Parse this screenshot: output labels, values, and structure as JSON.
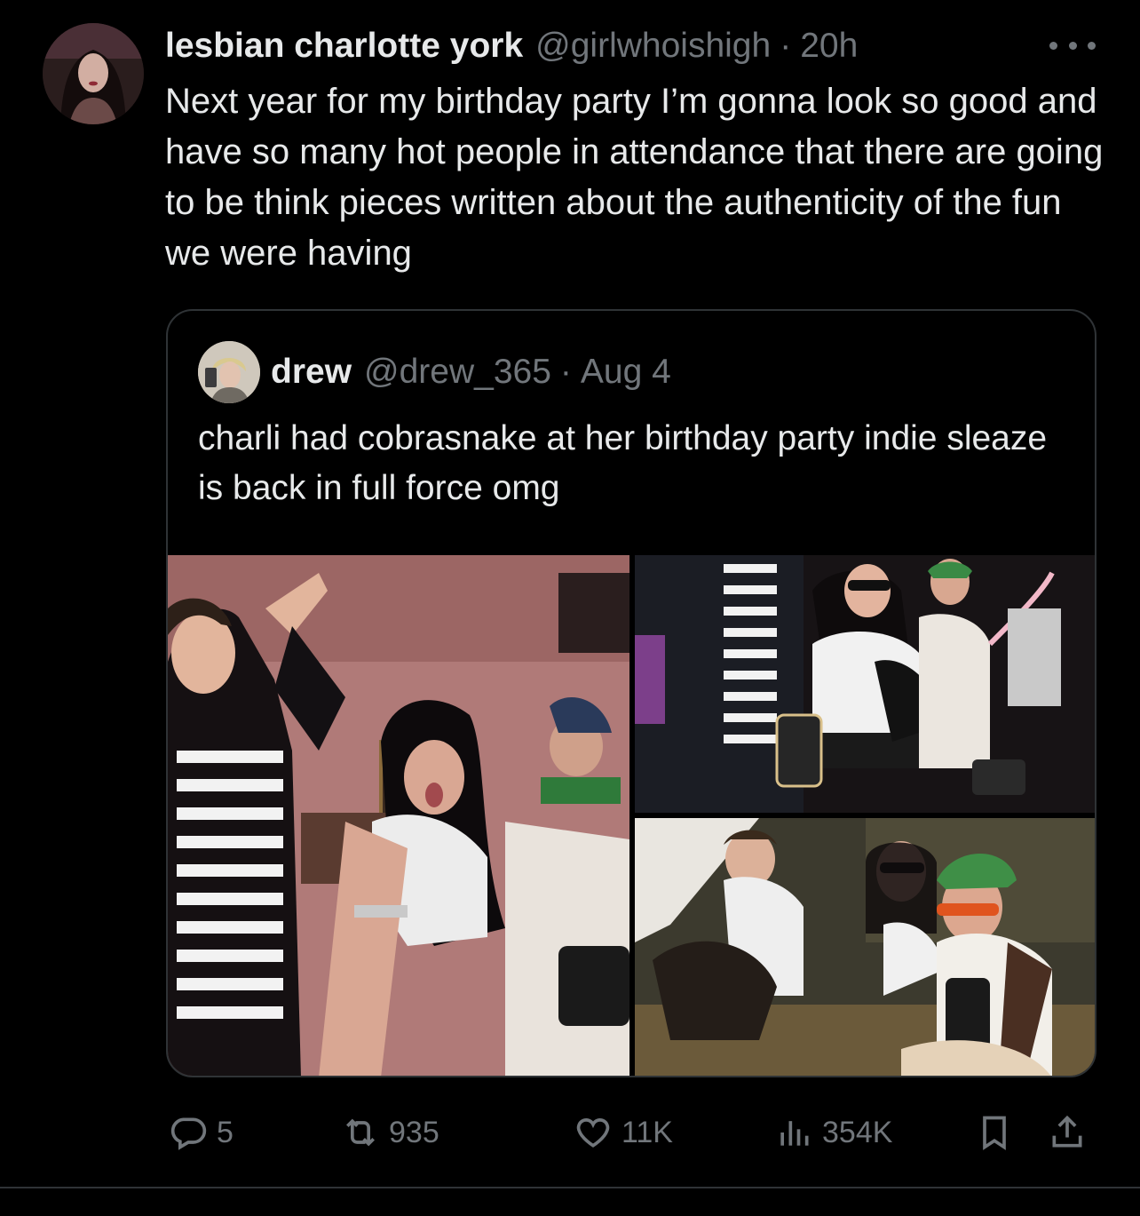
{
  "tweet": {
    "display_name": "lesbian charlotte york",
    "handle": "@girlwhoishigh",
    "separator": "·",
    "time": "20h",
    "text": "Next year for my birthday party I’m gonna look so good and have so many hot people in attendance that there are going to be think pieces written about the authenticity of the fun we were having",
    "avatar_icon": "user-avatar"
  },
  "quote": {
    "display_name": "drew",
    "handle": "@drew_365",
    "separator": "·",
    "date": "Aug 4",
    "text": "charli had cobrasnake at her birthday party indie sleaze is back in full force omg",
    "photos": [
      "party-photo-1",
      "party-photo-2",
      "party-photo-3"
    ]
  },
  "actions": {
    "reply_count": "5",
    "retweet_count": "935",
    "like_count": "11K",
    "views_count": "354K",
    "icons": [
      "reply-icon",
      "retweet-icon",
      "like-icon",
      "views-icon",
      "bookmark-icon",
      "share-icon"
    ]
  },
  "colors": {
    "background": "#000000",
    "text_primary": "#e7e9ea",
    "text_secondary": "#71767b",
    "border": "#2f3336"
  }
}
